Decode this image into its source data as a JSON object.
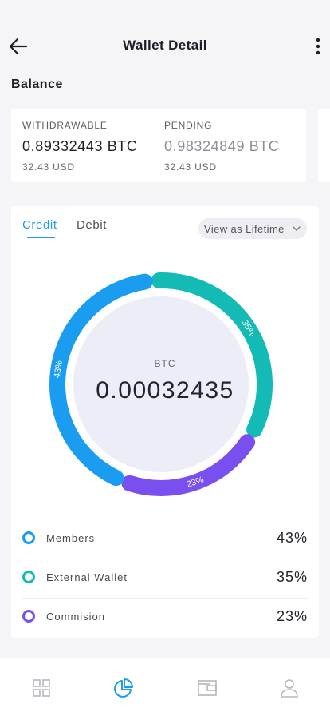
{
  "header": {
    "title": "Wallet Detail"
  },
  "balance": {
    "section_title": "Balance",
    "withdrawable": {
      "label": "WITHDRAWABLE",
      "amount": "0.89332443 BTC",
      "usd": "32.43 USD"
    },
    "pending": {
      "label": "PENDING",
      "amount": "0.98324849 BTC",
      "usd": "32.43 USD"
    }
  },
  "chart_card": {
    "tabs": [
      {
        "label": "Credit",
        "active": true
      },
      {
        "label": "Debit",
        "active": false
      }
    ],
    "period_select": {
      "selected": "View as Lifetime"
    },
    "center": {
      "unit": "BTC",
      "value": "0.00032435"
    }
  },
  "chart_data": {
    "type": "pie",
    "categories": [
      "Members",
      "External Wallet",
      "Commision"
    ],
    "values": [
      43,
      35,
      23
    ],
    "value_labels": [
      "43%",
      "35%",
      "23%"
    ],
    "colors": [
      "#1a9cf0",
      "#13bbb4",
      "#7a4ff0"
    ]
  },
  "legend": [
    {
      "name": "Members",
      "value": "43%",
      "color": "#1a9cf0"
    },
    {
      "name": "External Wallet",
      "value": "35%",
      "color": "#13bbb4"
    },
    {
      "name": "Commision",
      "value": "23%",
      "color": "#7a4ff0"
    }
  ],
  "bottom_nav": {
    "items": [
      {
        "icon": "grid-icon",
        "active": false
      },
      {
        "icon": "pie-chart-icon",
        "active": true
      },
      {
        "icon": "wallet-icon",
        "active": false
      },
      {
        "icon": "user-icon",
        "active": false
      }
    ]
  },
  "colors": {
    "accent": "#1a9cf0",
    "teal": "#13bbb4",
    "purple": "#7a4ff0",
    "center_fill": "#ededf8"
  }
}
